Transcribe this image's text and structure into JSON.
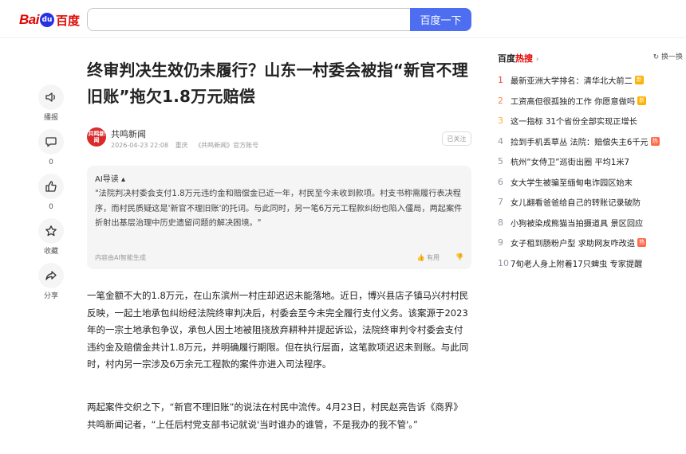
{
  "header": {
    "logo_bai": "Bai",
    "logo_du": "du",
    "logo_cn": "百度",
    "search_placeholder": "",
    "search_button": "百度一下"
  },
  "rail": [
    {
      "label": "播报",
      "icon": "speaker-icon"
    },
    {
      "label": "0",
      "icon": "comment-icon"
    },
    {
      "label": "0",
      "icon": "like-icon"
    },
    {
      "label": "收藏",
      "icon": "star-icon"
    },
    {
      "label": "分享",
      "icon": "share-icon"
    }
  ],
  "article": {
    "title": "终审判决生效仍未履行？山东一村委会被指“新官不理旧账”拖欠1.8万元赔偿",
    "author": {
      "avatar_text": "共鸣新闻",
      "name": "共鸣新闻",
      "time": "2026-04-23 22:08",
      "location": "重庆",
      "account": "《共鸣新闻》官方账号",
      "follow": "已关注"
    },
    "ai": {
      "heading": "AI导读 ▴",
      "text": "\"法院判决村委会支付1.8万元违约金和赔偿金已近一年，村民至今未收到款项。村支书称需履行表决程序，而村民质疑这是'新官不理旧账'的托词。与此同时，另一笔6万元工程款纠纷也陷入僵局，两起案件折射出基层治理中历史遗留问题的解决困境。\"",
      "footer": "内容由AI智能生成",
      "useful": "有用"
    },
    "paragraphs": [
      "一笔金额不大的1.8万元，在山东滨州一村庄却迟迟未能落地。近日，博兴县店子镇马兴村村民反映，一起土地承包纠纷经法院终审判决后，村委会至今未完全履行支付义务。该案源于2023年的一宗土地承包争议，承包人因土地被阻挠放弃耕种并提起诉讼，法院终审判令村委会支付违约金及赔偿金共计1.8万元，并明确履行期限。但在执行层面，这笔款项迟迟未到账。与此同时，村内另一宗涉及6万余元工程款的案件亦进入司法程序。",
      "两起案件交织之下，“新官不理旧账”的说法在村民中流传。4月23日，村民赵亮告诉《商界》共鸣新闻记者，“上任后村党支部书记就说'当时谁办的谁管，不是我办的我不管'。”"
    ]
  },
  "hotlist": {
    "title_a": "百度",
    "title_b": "热搜",
    "switch": "换一换",
    "items": [
      {
        "rank": "1",
        "text": "最新亚洲大学排名：清华北大前二",
        "tag": "新"
      },
      {
        "rank": "2",
        "text": "工资高但很孤独的工作 你愿意做吗",
        "tag": "新"
      },
      {
        "rank": "3",
        "text": "这一指标 31个省份全部实现正增长",
        "tag": ""
      },
      {
        "rank": "4",
        "text": "捡到手机丢草丛 法院：赔偿失主6千元",
        "tag": "热"
      },
      {
        "rank": "5",
        "text": "杭州“女侍卫”巡街出圈 平均1米7",
        "tag": ""
      },
      {
        "rank": "6",
        "text": "女大学生被骗至缅甸电诈园区始末",
        "tag": ""
      },
      {
        "rank": "7",
        "text": "女儿翻看爸爸给自己的转账记录破防",
        "tag": ""
      },
      {
        "rank": "8",
        "text": "小狗被染成熊猫当拍摄道具 景区回应",
        "tag": ""
      },
      {
        "rank": "9",
        "text": "女子租到肠粉户型 求助网友咋改造",
        "tag": "热"
      },
      {
        "rank": "10",
        "text": "7旬老人身上附着17只蜱虫 专家提醒",
        "tag": ""
      }
    ]
  },
  "colors": {
    "accent": "#4e6ef2",
    "brand_red": "#e10602",
    "rank1": "#f54545",
    "rank2": "#ff8547",
    "rank3": "#ffac38"
  }
}
